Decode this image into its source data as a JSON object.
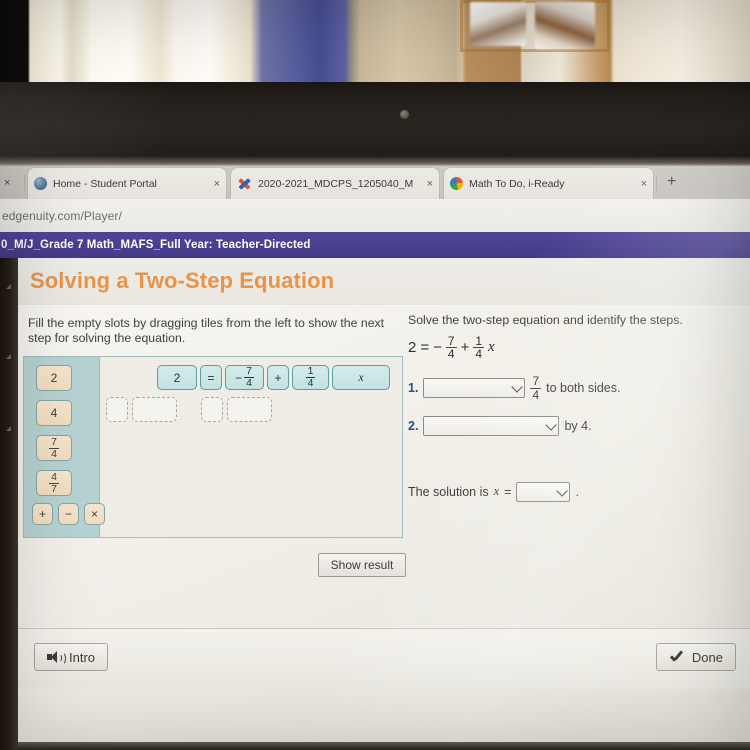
{
  "browser": {
    "tabs": [
      {
        "label": "Home - Student Portal",
        "favicon": "globe-icon",
        "close": "×"
      },
      {
        "label": "2020-2021_MDCPS_1205040_M",
        "favicon": "x-logo-icon",
        "close": "×"
      },
      {
        "label": "Math To Do, i-Ready",
        "favicon": "iready-icon",
        "close": "×"
      }
    ],
    "partial_tab_close": "×",
    "new_tab_label": "+",
    "url": "edgenuity.com/Player/"
  },
  "course": {
    "banner_title": "0_M/J_Grade 7 Math_MAFS_Full Year: Teacher-Directed",
    "banner_color": "#4a3f92"
  },
  "lesson": {
    "title": "Solving a Two-Step Equation",
    "title_color": "#e8944b",
    "instructions": "Fill the empty slots by dragging tiles from the left to show the next step for solving the equation."
  },
  "activity": {
    "tray_tiles": [
      {
        "type": "number",
        "value": "2"
      },
      {
        "type": "number",
        "value": "4"
      },
      {
        "type": "fraction",
        "num": "7",
        "den": "4"
      },
      {
        "type": "fraction",
        "num": "4",
        "den": "7"
      }
    ],
    "operator_tiles": [
      "+",
      "−",
      "×"
    ],
    "equation_tiles": [
      {
        "type": "number",
        "value": "2"
      },
      {
        "type": "operator",
        "value": "="
      },
      {
        "type": "signed-fraction",
        "sign": "−",
        "num": "7",
        "den": "4"
      },
      {
        "type": "operator",
        "value": "+"
      },
      {
        "type": "fraction",
        "num": "1",
        "den": "4"
      },
      {
        "type": "variable",
        "value": "x"
      }
    ],
    "empty_slots": [
      "",
      "",
      "",
      ""
    ],
    "show_result_label": "Show result"
  },
  "right_panel": {
    "prompt": "Solve the two-step equation and identify the steps.",
    "equation": {
      "lhs": "2",
      "eq": "=",
      "sign": "−",
      "frac1_num": "7",
      "frac1_den": "4",
      "plus": "+",
      "frac2_num": "1",
      "frac2_den": "4",
      "var": "x"
    },
    "steps": [
      {
        "number": "1.",
        "select_value": "",
        "frac_num": "7",
        "frac_den": "4",
        "trailing": "to both sides."
      },
      {
        "number": "2.",
        "select_value": "",
        "trailing": "by 4."
      }
    ],
    "solution_prefix": "The solution is",
    "solution_var": "x",
    "solution_equals": "=",
    "solution_select_value": "",
    "solution_period": "."
  },
  "footer": {
    "intro_label": "Intro",
    "intro_icon": "speaker-icon",
    "done_label": "Done",
    "done_icon": "checkmark-icon"
  }
}
